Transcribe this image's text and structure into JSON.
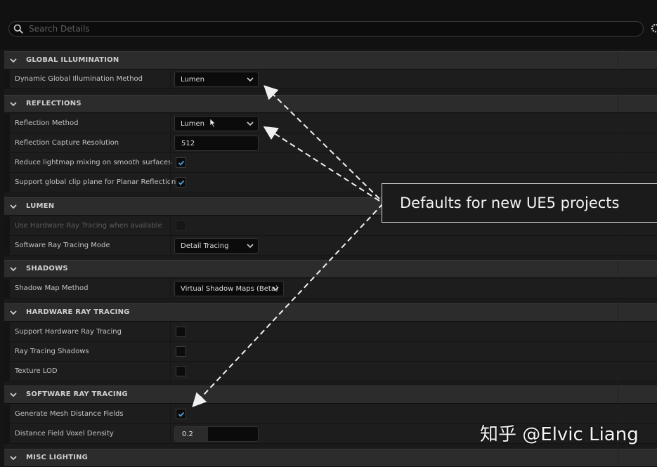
{
  "search": {
    "placeholder": "Search Details"
  },
  "sections": {
    "global_illumination": {
      "title": "GLOBAL ILLUMINATION",
      "rows": {
        "dgi_method": {
          "label": "Dynamic Global Illumination Method",
          "value": "Lumen"
        }
      }
    },
    "reflections": {
      "title": "REFLECTIONS",
      "rows": {
        "reflection_method": {
          "label": "Reflection Method",
          "value": "Lumen"
        },
        "capture_resolution": {
          "label": "Reflection Capture Resolution",
          "value": "512"
        },
        "reduce_lightmap": {
          "label": "Reduce lightmap mixing on smooth surfaces",
          "checked": true
        },
        "clip_plane": {
          "label": "Support global clip plane for Planar Reflections",
          "checked": true
        }
      }
    },
    "lumen": {
      "title": "LUMEN",
      "rows": {
        "hw_rt_available": {
          "label": "Use Hardware Ray Tracing when available",
          "checked": false,
          "disabled": true
        },
        "sw_rt_mode": {
          "label": "Software Ray Tracing Mode",
          "value": "Detail Tracing"
        }
      }
    },
    "shadows": {
      "title": "SHADOWS",
      "rows": {
        "shadow_map_method": {
          "label": "Shadow Map Method",
          "value": "Virtual Shadow Maps (Beta)"
        }
      }
    },
    "hardware_ray_tracing": {
      "title": "HARDWARE RAY TRACING",
      "rows": {
        "support_hw_rt": {
          "label": "Support Hardware Ray Tracing",
          "checked": false
        },
        "rt_shadows": {
          "label": "Ray Tracing Shadows",
          "checked": false
        },
        "texture_lod": {
          "label": "Texture LOD",
          "checked": false
        }
      }
    },
    "software_ray_tracing": {
      "title": "SOFTWARE RAY TRACING",
      "rows": {
        "gen_mesh_df": {
          "label": "Generate Mesh Distance Fields",
          "checked": true
        },
        "df_voxel_density": {
          "label": "Distance Field Voxel Density",
          "value": "0.2",
          "fraction": 0.4
        }
      }
    },
    "misc_lighting": {
      "title": "MISC LIGHTING"
    }
  },
  "callout": {
    "text": "Defaults for new UE5 projects"
  },
  "watermark": {
    "text": "知乎 @Elvic Liang"
  },
  "colors": {
    "checkmark": "#4aa3e0",
    "accent_panel": "#1a1a1a",
    "header": "#2c2c2c"
  }
}
